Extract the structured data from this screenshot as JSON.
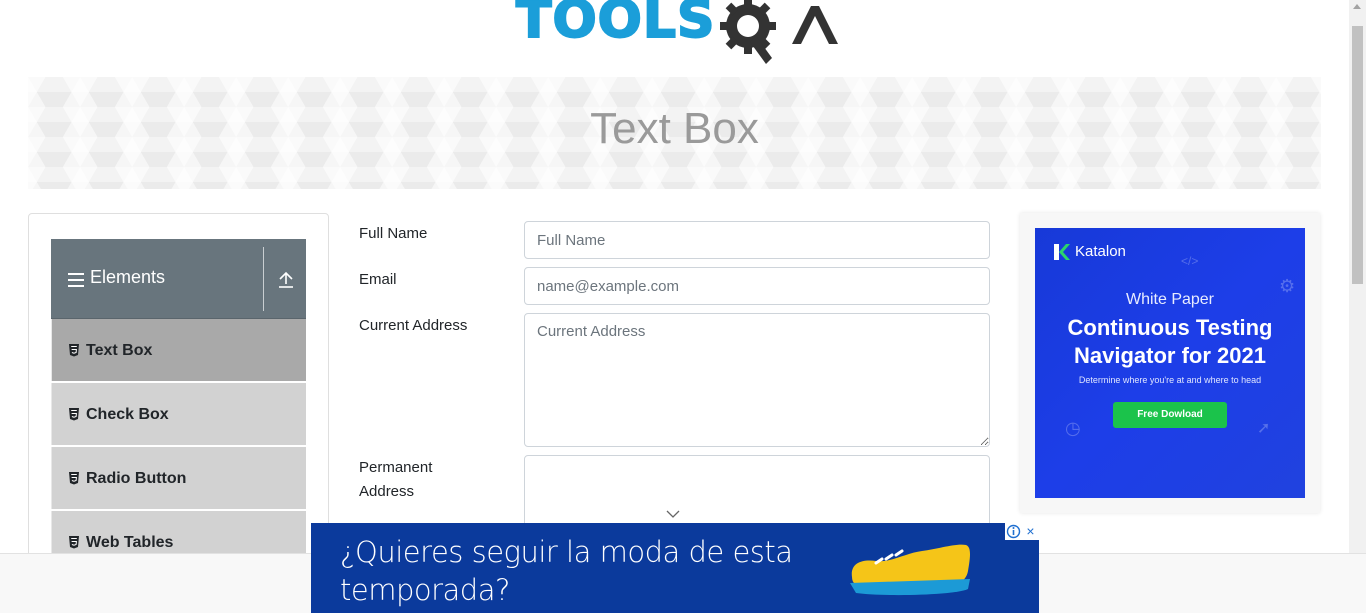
{
  "header": {
    "logo_text": "TOOLS",
    "logo_suffix": "QA"
  },
  "banner": {
    "title": "Text Box"
  },
  "sidebar": {
    "group_title": "Elements",
    "items": [
      {
        "label": "Text Box",
        "active": true
      },
      {
        "label": "Check Box",
        "active": false
      },
      {
        "label": "Radio Button",
        "active": false
      },
      {
        "label": "Web Tables",
        "active": false
      }
    ]
  },
  "form": {
    "full_name": {
      "label": "Full Name",
      "placeholder": "Full Name",
      "value": ""
    },
    "email": {
      "label": "Email",
      "placeholder": "name@example.com",
      "value": ""
    },
    "current_address": {
      "label": "Current Address",
      "placeholder": "Current Address",
      "value": ""
    },
    "permanent_address": {
      "label": "Permanent\nAddress",
      "label_line1": "Permanent",
      "label_line2": "Address",
      "value": ""
    }
  },
  "side_ad": {
    "brand": "Katalon",
    "kicker": "White Paper",
    "headline_line1": "Continuous Testing",
    "headline_line2": "Navigator for 2021",
    "subtext": "Determine where you're at and where to head",
    "cta": "Free Dowload",
    "colors": {
      "background": "#1d3ee8",
      "cta": "#1bc34b"
    }
  },
  "bottom_ad": {
    "text": "¿Quieres seguir la moda de esta temporada?",
    "close_icon": "×",
    "colors": {
      "background": "#0b3a9c",
      "shoe": "#f5c518"
    }
  },
  "colors": {
    "accent": "#1b9ed9",
    "group_header": "#68757d",
    "active_item": "#a9a9a9",
    "menu_item": "#d2d2d2"
  }
}
